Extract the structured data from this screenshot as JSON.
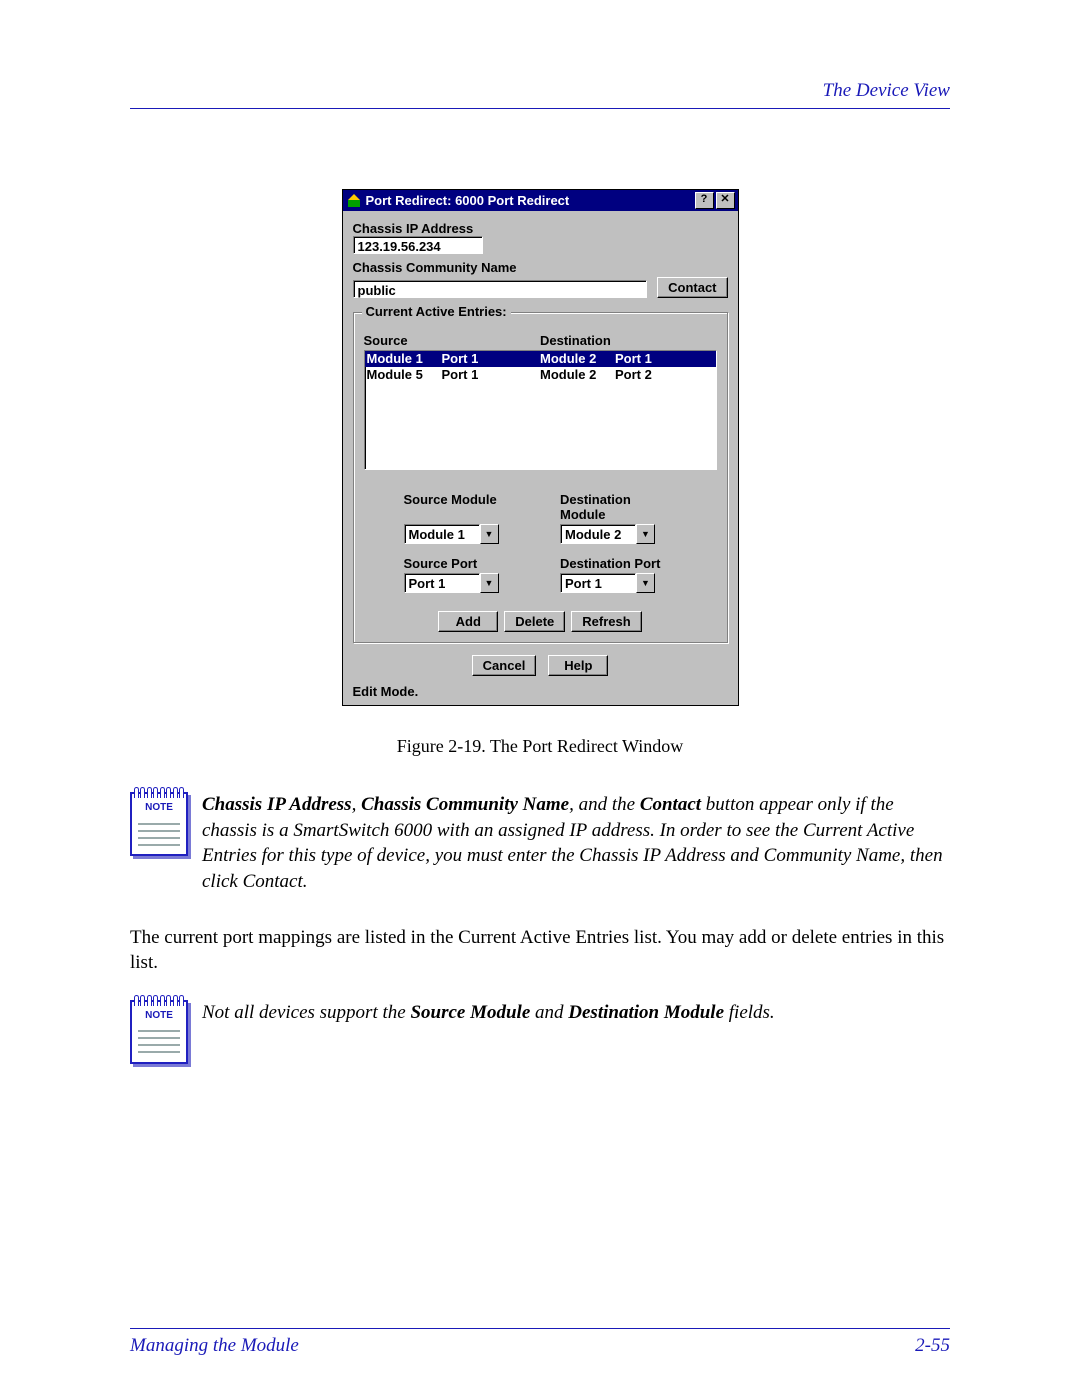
{
  "header": {
    "section": "The Device View"
  },
  "dialog": {
    "title": "Port Redirect: 6000 Port Redirect",
    "help_btn": "?",
    "close_btn": "✕",
    "ip_label": "Chassis IP Address",
    "ip_value": "123.19.56.234",
    "comm_label": "Chassis Community Name",
    "comm_value": "public",
    "contact_btn": "Contact",
    "entries_group": "Current Active Entries:",
    "col_source": "Source",
    "col_dest": "Destination",
    "rows": [
      {
        "src_mod": "Module 1",
        "src_port": "Port 1",
        "dst_mod": "Module 2",
        "dst_port": "Port 1",
        "selected": true
      },
      {
        "src_mod": "Module 5",
        "src_port": "Port 1",
        "dst_mod": "Module 2",
        "dst_port": "Port 2",
        "selected": false
      }
    ],
    "src_mod_label": "Source Module",
    "dst_mod_label": "Destination Module",
    "src_port_label": "Source Port",
    "dst_port_label": "Destination Port",
    "src_mod_val": "Module 1",
    "dst_mod_val": "Module 2",
    "src_port_val": "Port 1",
    "dst_port_val": "Port 1",
    "add_btn": "Add",
    "delete_btn": "Delete",
    "refresh_btn": "Refresh",
    "cancel_btn": "Cancel",
    "help2_btn": "Help",
    "status": "Edit Mode."
  },
  "figure_caption": "Figure 2-19. The Port Redirect Window",
  "note1": {
    "icon_label": "NOTE",
    "prefix1": "Chassis IP Address",
    "sep1": ", ",
    "prefix2": "Chassis Community Name",
    "mid": ", and the ",
    "prefix3": "Contact",
    "rest": " button appear only if the chassis is a SmartSwitch 6000 with an assigned IP address. In order to see the Current Active Entries for this type of device, you must enter the Chassis IP Address and Community Name, then click Contact."
  },
  "body_para": "The current port mappings are listed in the Current Active Entries list. You may add or delete entries in this list.",
  "note2": {
    "icon_label": "NOTE",
    "pre": "Not all devices support the ",
    "b1": "Source Module",
    "mid": " and ",
    "b2": "Destination Module",
    "post": " fields."
  },
  "footer": {
    "left": "Managing the Module",
    "right": "2-55"
  }
}
